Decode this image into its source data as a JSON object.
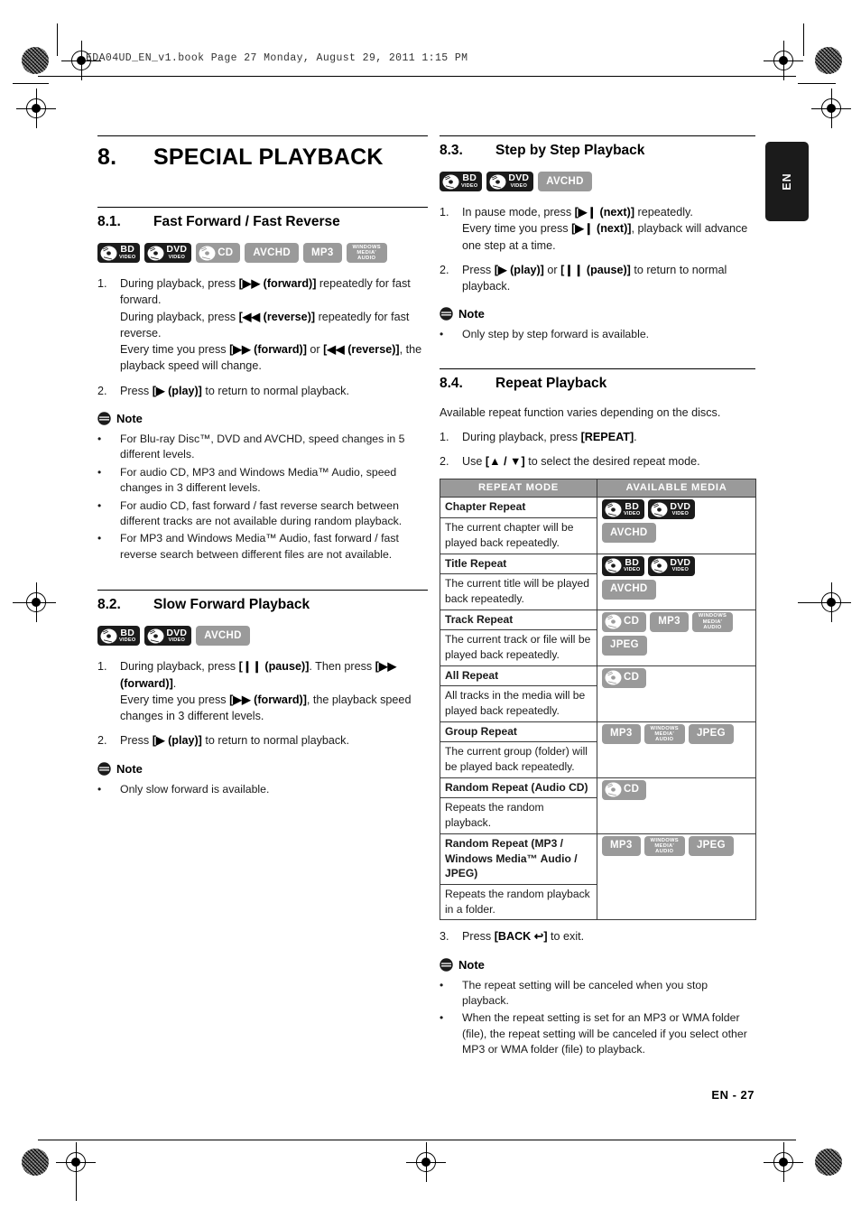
{
  "page": {
    "book_header": "EDA04UD_EN_v1.book  Page 27  Monday, August 29, 2011  1:15 PM",
    "side_tab": "EN",
    "footer": "EN - 27"
  },
  "chapter": {
    "number": "8.",
    "title": "SPECIAL PLAYBACK"
  },
  "sections": {
    "fast_forward": {
      "number": "8.1.",
      "title": "Fast Forward / Fast Reverse",
      "badges": [
        "bd-video",
        "dvd-video",
        "cd",
        "avchd",
        "mp3",
        "wma"
      ],
      "step1_marker": "1.",
      "step1_line1_a": "During playback, press ",
      "step1_line1_b": "[▶▶ (forward)]",
      "step1_line1_c": " repeatedly for fast forward.",
      "step1_line2_a": "During playback, press ",
      "step1_line2_b": "[◀◀ (reverse)]",
      "step1_line2_c": " repeatedly for fast reverse.",
      "step1_line3_a": "Every time you press ",
      "step1_line3_b": "[▶▶ (forward)]",
      "step1_line3_c": " or ",
      "step1_line3_d": "[◀◀ (reverse)]",
      "step1_line3_e": ", the playback speed will change.",
      "step2_marker": "2.",
      "step2_a": "Press ",
      "step2_b": "[▶ (play)]",
      "step2_c": " to return to normal playback.",
      "note_title": "Note",
      "notes": [
        "For Blu-ray Disc™, DVD and AVCHD, speed changes in 5 different levels.",
        "For audio CD, MP3 and Windows Media™ Audio, speed changes in 3 different levels.",
        "For audio CD, fast forward / fast reverse search between different tracks are not available during random playback.",
        "For MP3 and Windows Media™ Audio, fast forward / fast reverse search between different files are not available."
      ]
    },
    "slow_forward": {
      "number": "8.2.",
      "title": "Slow Forward Playback",
      "badges": [
        "bd-video",
        "dvd-video",
        "avchd"
      ],
      "step1_marker": "1.",
      "step1_line1_a": "During playback, press ",
      "step1_line1_b": "[❙❙ (pause)]",
      "step1_line1_c": ". Then press ",
      "step1_line1_d": "[▶▶ (forward)]",
      "step1_line1_e": ".",
      "step1_line2_a": "Every time you press ",
      "step1_line2_b": "[▶▶ (forward)]",
      "step1_line2_c": ", the playback speed changes in 3 different levels.",
      "step2_marker": "2.",
      "step2_a": "Press ",
      "step2_b": "[▶ (play)]",
      "step2_c": " to return to normal playback.",
      "note_title": "Note",
      "notes": [
        "Only slow forward is available."
      ]
    },
    "step_by_step": {
      "number": "8.3.",
      "title": "Step by Step Playback",
      "badges": [
        "bd-video",
        "dvd-video",
        "avchd"
      ],
      "step1_marker": "1.",
      "step1_line1_a": "In pause mode, press ",
      "step1_line1_b": "[▶❙ (next)]",
      "step1_line1_c": " repeatedly.",
      "step1_line2_a": "Every time you press ",
      "step1_line2_b": "[▶❙ (next)]",
      "step1_line2_c": ", playback will advance one step at a time.",
      "step2_marker": "2.",
      "step2_a": "Press ",
      "step2_b": "[▶ (play)]",
      "step2_c": " or ",
      "step2_d": "[❙❙ (pause)]",
      "step2_e": " to return to normal playback.",
      "note_title": "Note",
      "notes": [
        "Only step by step forward is available."
      ]
    },
    "repeat": {
      "number": "8.4.",
      "title": "Repeat Playback",
      "intro": "Available repeat function varies depending on the discs.",
      "step1_marker": "1.",
      "step1_a": "During playback, press ",
      "step1_b": "[REPEAT]",
      "step1_c": ".",
      "step2_marker": "2.",
      "step2_a": "Use ",
      "step2_b": "[▲ / ▼]",
      "step2_c": " to select the desired repeat mode.",
      "step3_marker": "3.",
      "step3_a": "Press ",
      "step3_b": "[BACK ↩]",
      "step3_c": " to exit.",
      "note_title": "Note",
      "notes": [
        "The repeat setting will be canceled when you stop playback.",
        "When the repeat setting is set for an MP3 or WMA folder (file), the repeat setting will be canceled if you select other MP3 or WMA folder (file) to playback."
      ]
    }
  },
  "repeat_table": {
    "headers": [
      "REPEAT MODE",
      "AVAILABLE MEDIA"
    ],
    "rows": [
      {
        "mode": "Chapter Repeat",
        "desc": "The current chapter will be played back repeatedly.",
        "media": [
          "bd-video",
          "dvd-video",
          "avchd"
        ]
      },
      {
        "mode": "Title Repeat",
        "desc": "The current title will be played back repeatedly.",
        "media": [
          "bd-video",
          "dvd-video",
          "avchd"
        ]
      },
      {
        "mode": "Track Repeat",
        "desc": "The current track or file will be played back repeatedly.",
        "media": [
          "cd",
          "mp3",
          "wma",
          "jpeg"
        ]
      },
      {
        "mode": "All Repeat",
        "desc": "All tracks in the media will be played back repeatedly.",
        "media": [
          "cd"
        ]
      },
      {
        "mode": "Group Repeat",
        "desc": "The current group (folder) will be played back repeatedly.",
        "media": [
          "mp3",
          "wma",
          "jpeg"
        ]
      },
      {
        "mode": "Random Repeat (Audio CD)",
        "desc": "Repeats the random playback.",
        "media": [
          "cd"
        ]
      },
      {
        "mode": "Random Repeat (MP3 / Windows Media™ Audio / JPEG)",
        "desc": "Repeats the random playback in a folder.",
        "media": [
          "mp3",
          "wma",
          "jpeg"
        ]
      }
    ]
  },
  "badge_labels": {
    "bd-video": {
      "l1": "BD",
      "l2": "VIDEO",
      "style": "dark"
    },
    "dvd-video": {
      "l1": "DVD",
      "l2": "VIDEO",
      "style": "dark"
    },
    "cd": {
      "l1": "CD",
      "style": "gray"
    },
    "avchd": {
      "l1": "AVCHD",
      "style": "gray"
    },
    "mp3": {
      "l1": "MP3",
      "style": "gray"
    },
    "wma": {
      "l1": "WINDOWS",
      "l2": "MEDIA’",
      "l3": "AUDIO",
      "style": "gray"
    },
    "jpeg": {
      "l1": "JPEG",
      "style": "gray"
    }
  },
  "colors": {
    "badge_dark": "#1b1b1b",
    "badge_gray": "#9a9a9a",
    "table_header": "#9a9a9a",
    "text": "#1a1a1a"
  }
}
